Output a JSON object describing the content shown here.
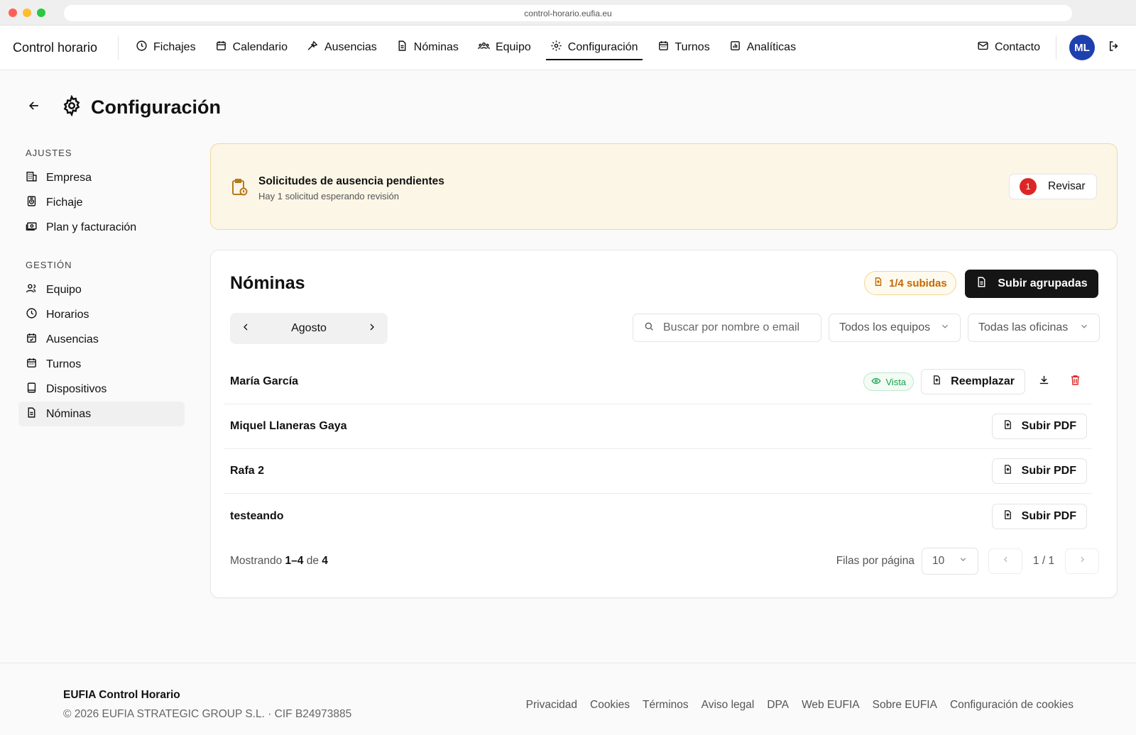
{
  "browser": {
    "url": "control-horario.eufia.eu"
  },
  "nav": {
    "brand": "Control horario",
    "items": [
      {
        "label": "Fichajes",
        "icon": "clock-icon"
      },
      {
        "label": "Calendario",
        "icon": "calendar-icon"
      },
      {
        "label": "Ausencias",
        "icon": "plane-icon"
      },
      {
        "label": "Nóminas",
        "icon": "document-icon"
      },
      {
        "label": "Equipo",
        "icon": "team-icon"
      },
      {
        "label": "Configuración",
        "icon": "gear-icon",
        "active": true
      },
      {
        "label": "Turnos",
        "icon": "calendar-icon"
      },
      {
        "label": "Analíticas",
        "icon": "chart-icon"
      }
    ],
    "contact": "Contacto",
    "avatar_initials": "ML"
  },
  "page": {
    "title": "Configuración"
  },
  "sidebar": {
    "groups": [
      {
        "title": "AJUSTES",
        "items": [
          {
            "label": "Empresa",
            "icon": "building-icon"
          },
          {
            "label": "Fichaje",
            "icon": "clock-device-icon"
          },
          {
            "label": "Plan y facturación",
            "icon": "billing-icon"
          }
        ]
      },
      {
        "title": "GESTIÓN",
        "items": [
          {
            "label": "Equipo",
            "icon": "users-icon"
          },
          {
            "label": "Horarios",
            "icon": "clock-icon"
          },
          {
            "label": "Ausencias",
            "icon": "calendar-check-icon"
          },
          {
            "label": "Turnos",
            "icon": "calendar-icon"
          },
          {
            "label": "Dispositivos",
            "icon": "tablet-icon"
          },
          {
            "label": "Nóminas",
            "icon": "document-icon",
            "active": true
          }
        ]
      }
    ]
  },
  "alert": {
    "title": "Solicitudes de ausencia pendientes",
    "subtitle": "Hay 1 solicitud esperando revisión",
    "badge": "1",
    "button": "Revisar"
  },
  "payroll": {
    "title": "Nóminas",
    "uploaded_badge": "1/4 subidas",
    "group_upload_button": "Subir agrupadas",
    "month": "Agosto",
    "search_placeholder": "Buscar por nombre o email",
    "teams_filter": "Todos los equipos",
    "offices_filter": "Todas las oficinas",
    "rows": [
      {
        "name": "María García",
        "status": "Vista",
        "action": "Reemplazar",
        "uploaded": true
      },
      {
        "name": "Miquel Llaneras Gaya",
        "action": "Subir PDF",
        "uploaded": false
      },
      {
        "name": "Rafa 2",
        "action": "Subir PDF",
        "uploaded": false
      },
      {
        "name": "testeando",
        "action": "Subir PDF",
        "uploaded": false
      }
    ],
    "showing_prefix": "Mostrando",
    "showing_range": "1–4",
    "showing_of": "de",
    "showing_total": "4",
    "rows_per_page_label": "Filas por página",
    "rows_per_page": "10",
    "page_indicator": "1 / 1"
  },
  "footer": {
    "brand": "EUFIA Control Horario",
    "copyright": "© 2026 EUFIA STRATEGIC GROUP S.L. · CIF B24973885",
    "links": [
      "Privacidad",
      "Cookies",
      "Términos",
      "Aviso legal",
      "DPA",
      "Web EUFIA",
      "Sobre EUFIA",
      "Configuración de cookies"
    ]
  },
  "colors": {
    "accent": "#151515",
    "avatar": "#1e40af",
    "danger": "#dc2626",
    "success": "#16a34a",
    "warning": "#c46a00"
  }
}
